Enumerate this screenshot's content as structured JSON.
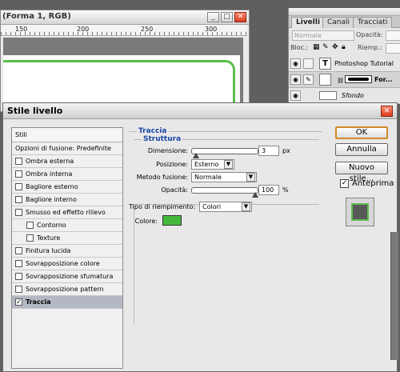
{
  "document": {
    "title": "(Forma 1, RGB)",
    "ruler_marks": [
      "150",
      "200",
      "250",
      "300"
    ]
  },
  "layers_panel": {
    "tabs": [
      "Livelli",
      "Canali",
      "Tracciati"
    ],
    "blend_mode": "Normale",
    "opacity_label": "Opacità:",
    "lock_label": "Bloc.:",
    "fill_label": "Riemp.:",
    "layers": [
      {
        "name": "Photoshop Tutorial",
        "thumb": "T"
      },
      {
        "name": "For...",
        "thumb": ""
      },
      {
        "name": "Sfondo",
        "thumb": ""
      }
    ]
  },
  "dialog": {
    "title": "Stile livello",
    "list_header": "Stili",
    "styles": [
      {
        "label": "Opzioni di fusione: Predefinite",
        "checkbox": false,
        "checked": false,
        "indent": false,
        "selected": false
      },
      {
        "label": "Ombra esterna",
        "checkbox": true,
        "checked": false,
        "indent": false,
        "selected": false
      },
      {
        "label": "Ombra interna",
        "checkbox": true,
        "checked": false,
        "indent": false,
        "selected": false
      },
      {
        "label": "Bagliore esterno",
        "checkbox": true,
        "checked": false,
        "indent": false,
        "selected": false
      },
      {
        "label": "Bagliore interno",
        "checkbox": true,
        "checked": false,
        "indent": false,
        "selected": false
      },
      {
        "label": "Smusso ed effetto rilievo",
        "checkbox": true,
        "checked": false,
        "indent": false,
        "selected": false
      },
      {
        "label": "Contorno",
        "checkbox": true,
        "checked": false,
        "indent": true,
        "selected": false
      },
      {
        "label": "Texture",
        "checkbox": true,
        "checked": false,
        "indent": true,
        "selected": false
      },
      {
        "label": "Finitura lucida",
        "checkbox": true,
        "checked": false,
        "indent": false,
        "selected": false
      },
      {
        "label": "Sovrapposizione colore",
        "checkbox": true,
        "checked": false,
        "indent": false,
        "selected": false
      },
      {
        "label": "Sovrapposizione sfumatura",
        "checkbox": true,
        "checked": false,
        "indent": false,
        "selected": false
      },
      {
        "label": "Sovrapposizione pattern",
        "checkbox": true,
        "checked": false,
        "indent": false,
        "selected": false
      },
      {
        "label": "Traccia",
        "checkbox": true,
        "checked": true,
        "indent": false,
        "selected": true
      }
    ],
    "section_title": "Traccia",
    "structure_title": "Struttura",
    "size_label": "Dimensione:",
    "size_value": "3",
    "size_unit": "px",
    "size_fraction": 0.03,
    "position_label": "Posizione:",
    "position_value": "Esterno",
    "blend_label": "Metodo fusione:",
    "blend_value": "Normale",
    "opacity_label": "Opacità:",
    "opacity_value": "100",
    "opacity_unit": "%",
    "opacity_fraction": 1.0,
    "fill_type_label": "Tipo di riempimento:",
    "fill_type_value": "Colori",
    "color_label": "Colore:",
    "stroke_color": "#44b83c",
    "buttons": {
      "ok": "OK",
      "cancel": "Annulla",
      "new_style": "Nuovo stile...",
      "preview": "Anteprima"
    },
    "preview_checked": true
  }
}
